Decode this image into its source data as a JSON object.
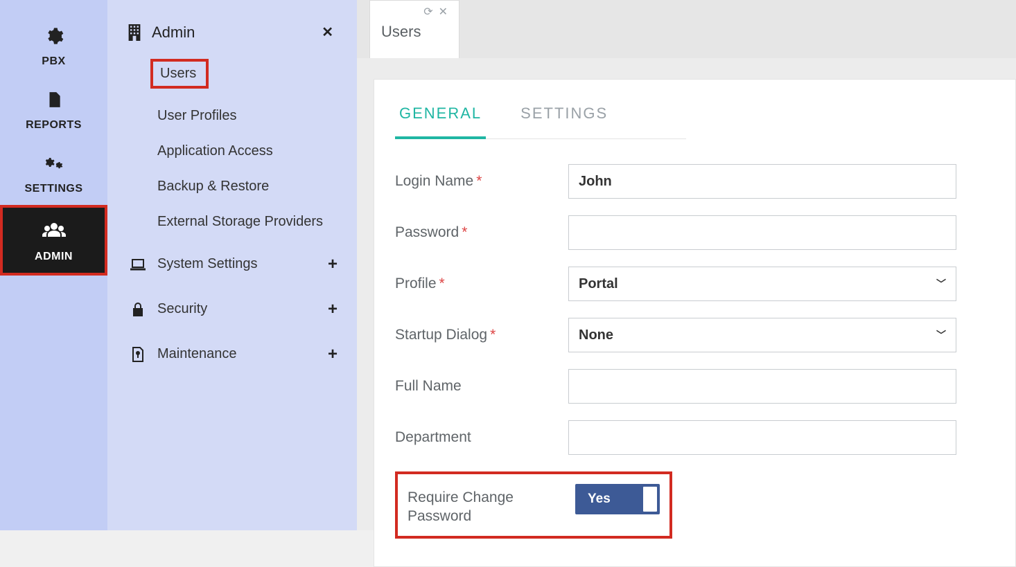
{
  "rail": {
    "items": [
      {
        "label": "PBX",
        "icon": "gear"
      },
      {
        "label": "REPORTS",
        "icon": "doc"
      },
      {
        "label": "SETTINGS",
        "icon": "gears"
      },
      {
        "label": "ADMIN",
        "icon": "users"
      }
    ]
  },
  "subpanel": {
    "title": "Admin",
    "items": [
      {
        "label": "Users"
      },
      {
        "label": "User Profiles"
      },
      {
        "label": "Application Access"
      },
      {
        "label": "Backup & Restore"
      },
      {
        "label": "External Storage Providers"
      },
      {
        "label": "System Settings",
        "icon": "laptop",
        "expandable": true
      },
      {
        "label": "Security",
        "icon": "lock",
        "expandable": true
      },
      {
        "label": "Maintenance",
        "icon": "file",
        "expandable": true
      }
    ]
  },
  "docTab": {
    "title": "Users"
  },
  "innerTabs": {
    "general": "GENERAL",
    "settings": "SETTINGS"
  },
  "form": {
    "loginName": {
      "label": "Login Name",
      "value": "John"
    },
    "password": {
      "label": "Password",
      "value": ""
    },
    "profile": {
      "label": "Profile",
      "value": "Portal"
    },
    "startupDialog": {
      "label": "Startup Dialog",
      "value": "None"
    },
    "fullName": {
      "label": "Full Name",
      "value": ""
    },
    "department": {
      "label": "Department",
      "value": ""
    },
    "requireChangePassword": {
      "label": "Require Change Password",
      "value": "Yes"
    }
  },
  "colors": {
    "accent": "#1fb6a3",
    "railBg": "#c2cdf5",
    "subpanelBg": "#d3daf6",
    "toggleBg": "#3d5a96",
    "highlight": "#d22b21"
  }
}
